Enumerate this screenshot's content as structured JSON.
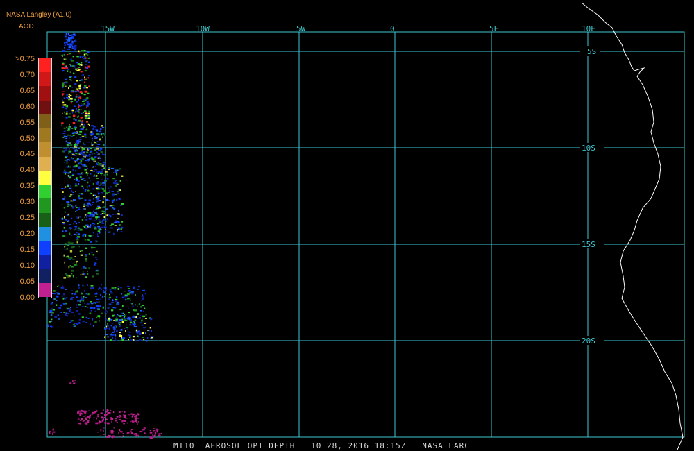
{
  "header": {
    "source": "NASA Langley (A1.0)",
    "product": "AOD"
  },
  "legend": {
    "labels": [
      ">0.75",
      "0.70",
      "0.65",
      "0.60",
      "0.55",
      "0.50",
      "0.45",
      "0.40",
      "0.35",
      "0.30",
      "0.25",
      "0.20",
      "0.15",
      "0.10",
      "0.05",
      "0.00"
    ],
    "colors": [
      "#ff2020",
      "#d01818",
      "#a01010",
      "#701010",
      "#806018",
      "#a07820",
      "#c09030",
      "#e0b050",
      "#ffff40",
      "#30d030",
      "#209820",
      "#186018",
      "#2090e0",
      "#1040ff",
      "#1020a0",
      "#102060",
      "#c02090"
    ]
  },
  "grid": {
    "lon_labels": [
      "15W",
      "10W",
      "5W",
      "0",
      "5E",
      "10E"
    ],
    "lat_labels": [
      "5S",
      "10S",
      "15S",
      "20S"
    ],
    "line_color": "#3ec8d0"
  },
  "caption": "MT10  AEROSOL OPT DEPTH   10 28, 2016 18:15Z   NASA LARC"
}
